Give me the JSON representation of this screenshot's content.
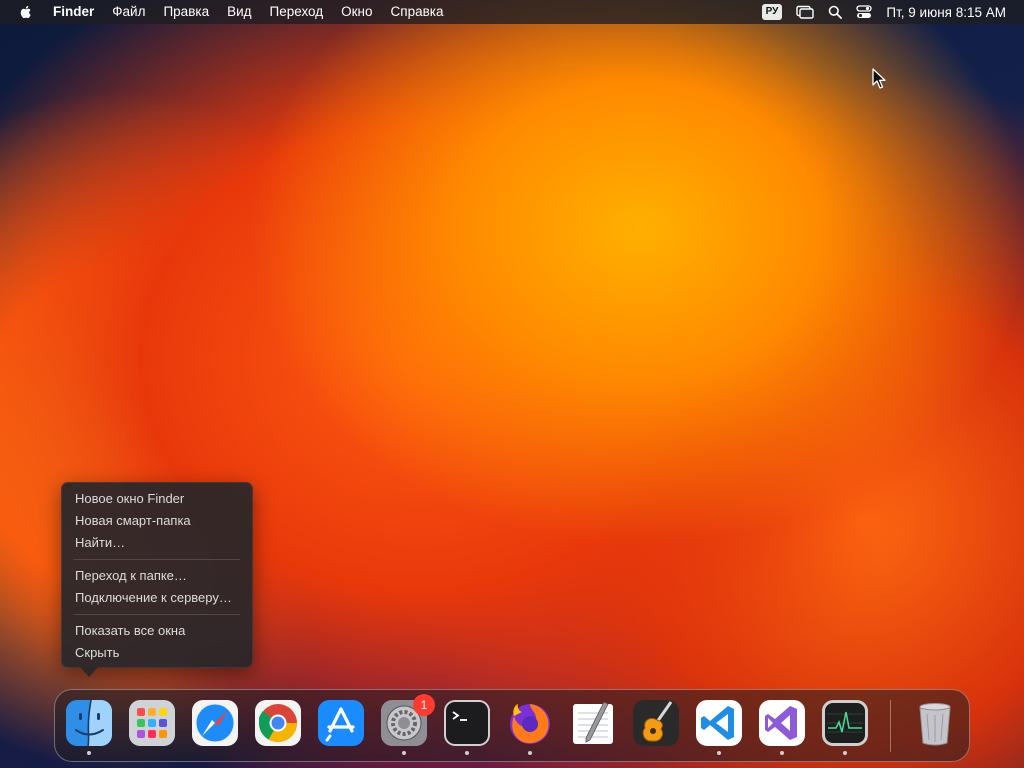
{
  "menubar": {
    "app_name": "Finder",
    "items": [
      "Файл",
      "Правка",
      "Вид",
      "Переход",
      "Окно",
      "Справка"
    ],
    "input_language": "РУ",
    "datetime": "Пт, 9 июня  8:15 AM"
  },
  "context_menu": {
    "group1": [
      "Новое окно Finder",
      "Новая смарт-папка",
      "Найти…"
    ],
    "group2": [
      "Переход к папке…",
      "Подключение к серверу…"
    ],
    "group3": [
      "Показать все окна",
      "Скрыть"
    ]
  },
  "dock": {
    "apps": [
      {
        "icon": "finder-icon",
        "running": true
      },
      {
        "icon": "launchpad-icon",
        "running": false
      },
      {
        "icon": "safari-icon",
        "running": false
      },
      {
        "icon": "chrome-icon",
        "running": false
      },
      {
        "icon": "app-store-icon",
        "running": false
      },
      {
        "icon": "system-preferences-icon",
        "running": true,
        "badge": "1"
      },
      {
        "icon": "terminal-icon",
        "running": true
      },
      {
        "icon": "firefox-icon",
        "running": true
      },
      {
        "icon": "textedit-icon",
        "running": false
      },
      {
        "icon": "garageband-icon",
        "running": false
      },
      {
        "icon": "vscode-icon",
        "running": true
      },
      {
        "icon": "visual-studio-icon",
        "running": true
      },
      {
        "icon": "activity-monitor-icon",
        "running": true
      },
      {
        "icon": "trash-icon",
        "running": false
      }
    ]
  },
  "colors": {
    "menubar_bg": "#1e1e22",
    "context_menu_bg": "#26262a",
    "badge": "#ff3b30"
  }
}
